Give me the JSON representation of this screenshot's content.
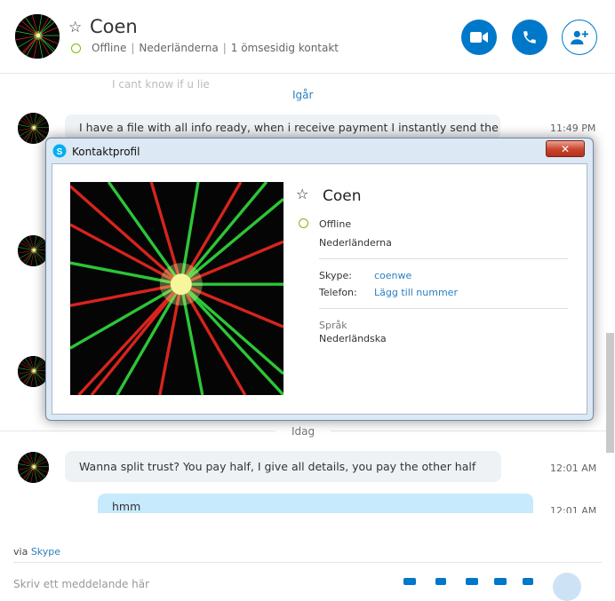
{
  "header": {
    "name": "Coen",
    "status": "Offline",
    "country": "Nederländerna",
    "mutual": "1 ömsesidig kontakt",
    "buttons": {
      "video": "video-icon",
      "call": "phone-icon",
      "add": "add-person-icon"
    }
  },
  "chat": {
    "ghost_text": "I cant know if u lie",
    "day_yesterday": "Igår",
    "day_today": "Idag",
    "messages": [
      {
        "text": "I have a file with all info ready, when i receive payment I instantly send the",
        "time": "11:49 PM"
      },
      {
        "text": "Wanna split trust? You pay half, I give all details, you pay the other half",
        "time": "12:01 AM"
      },
      {
        "text": "hmm",
        "time": "12:01 AM"
      }
    ]
  },
  "footer": {
    "via_prefix": "via",
    "via_link": "Skype",
    "compose_placeholder": "Skriv ett meddelande här"
  },
  "dialog": {
    "title": "Kontaktprofil",
    "close": "✕",
    "name": "Coen",
    "status": "Offline",
    "country": "Nederländerna",
    "skype_label": "Skype:",
    "skype_value": "coenwe",
    "phone_label": "Telefon:",
    "phone_value": "Lägg till nummer",
    "language_label": "Språk",
    "language_value": "Nederländska"
  },
  "colors": {
    "accent": "#0078ca",
    "online_ring": "#7fba00",
    "link": "#2a7fc1",
    "bubble_other": "#eef2f5",
    "bubble_me": "#c7eafc"
  }
}
